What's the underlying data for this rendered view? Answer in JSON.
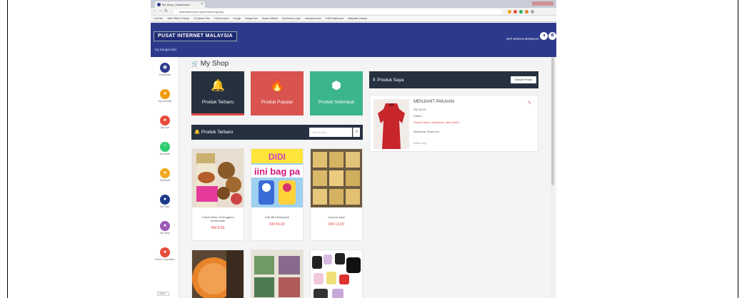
{
  "browser": {
    "tab_title": "My Shop | Dashboard",
    "url": "dashboard.pim.my/#/home/myshop",
    "bookmarks": [
      "YouTube",
      "After Effects Tutorial",
      "TM Speed Test",
      "PIJM Account",
      "Google",
      "Sungai Ular",
      "Sistem eBerari",
      "MyGeneric Login",
      "newuiprim.com",
      "PIJM Dashboard",
      "Integrated Human"
    ]
  },
  "header": {
    "logo_text": "PUSAT INTERNET MALAYSIA",
    "location": "Kg Sungai Ular",
    "user_name": "SITI SARAH BANILAH",
    "back_icon": "back-arrow-icon",
    "settings_icon": "gear-icon"
  },
  "sidebar": {
    "items": [
      {
        "label": "Dashboard",
        "icon": "dashboard-icon",
        "color": "#2d3a8c"
      },
      {
        "label": "My Komuniti",
        "icon": "community-icon",
        "color": "#f39c12"
      },
      {
        "label": "My Kool",
        "icon": "kool-icon",
        "color": "#e74c3c"
      },
      {
        "label": "My Health",
        "icon": "health-icon",
        "color": "#2ecc71"
      },
      {
        "label": "My Bisnis",
        "icon": "bisnis-icon",
        "color": "#f1a91f"
      },
      {
        "label": "My Place",
        "icon": "place-icon",
        "color": "#1f3a8c"
      },
      {
        "label": "My Shop",
        "icon": "shop-icon",
        "color": "#9b59b6"
      },
      {
        "label": "Power Competition",
        "icon": "power-icon",
        "color": "#e74c3c"
      }
    ],
    "zoom": "2000 +"
  },
  "main": {
    "page_title": "My Shop",
    "cards": [
      {
        "label": "Produk Terbaru",
        "icon": "bell-icon",
        "glyph": "🔔",
        "color": "#25313f"
      },
      {
        "label": "Produk Popular",
        "icon": "fire-icon",
        "glyph": "🔥",
        "color": "#d9534f"
      },
      {
        "label": "Produk Setempat",
        "icon": "cubes-icon",
        "glyph": "⬢",
        "color": "#3bb58a"
      }
    ],
    "latest_bar": {
      "title": "Produk Terbaru",
      "search_placeholder": "Cari Produk"
    },
    "products": [
      {
        "name": "Coklat Nissin Terengganu Homemade",
        "price": "RM 8.00"
      },
      {
        "name": "Didi Mini Backpack",
        "price": "RM 55.00"
      },
      {
        "name": "keropok raya",
        "price": "RM 13.00"
      }
    ],
    "my_products_bar": {
      "title": "Produk Saya",
      "add_button": "Tambah Produk"
    },
    "my_product": {
      "name": "MENJAHIT PAKAIAN",
      "price": "RM 35.00",
      "status_label": "Status:",
      "status_text": "Produk belum diluluskan oleh Admin",
      "info_label": "Maklumat Terperinci:",
      "info_value": "-",
      "more": "Baca Lagi"
    }
  }
}
